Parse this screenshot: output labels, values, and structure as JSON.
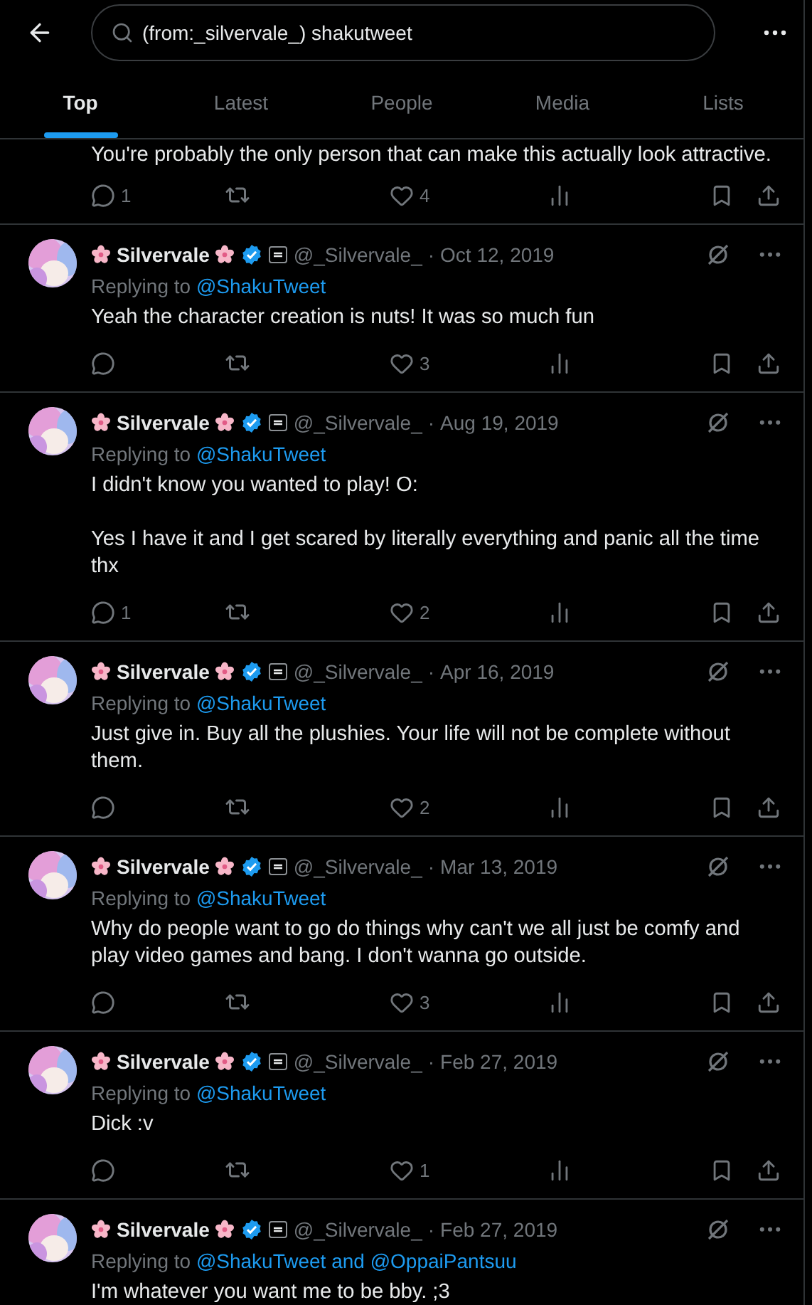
{
  "search": {
    "value": "(from:_silvervale_) shakutweet"
  },
  "tabs": [
    {
      "label": "Top",
      "selected": true
    },
    {
      "label": "Latest",
      "selected": false
    },
    {
      "label": "People",
      "selected": false
    },
    {
      "label": "Media",
      "selected": false
    },
    {
      "label": "Lists",
      "selected": false
    }
  ],
  "partial_tweet": {
    "text": [
      "You're probably the only person that can make this actually look attractive."
    ],
    "actions": {
      "replies": "1",
      "likes": "4"
    }
  },
  "tweets": [
    {
      "name": "Silvervale",
      "handle": "@_Silvervale_",
      "separator": "·",
      "date": "Oct 12, 2019",
      "replying_label": "Replying to",
      "replying_to": "@ShakuTweet",
      "text": [
        "Yeah the character creation is nuts! It was so much fun"
      ],
      "actions": {
        "likes": "3"
      }
    },
    {
      "name": "Silvervale",
      "handle": "@_Silvervale_",
      "separator": "·",
      "date": "Aug 19, 2019",
      "replying_label": "Replying to",
      "replying_to": "@ShakuTweet",
      "text": [
        "I didn't know you wanted to play! O:",
        "Yes I have it and I get scared by literally everything and panic all the time thx"
      ],
      "actions": {
        "replies": "1",
        "likes": "2"
      }
    },
    {
      "name": "Silvervale",
      "handle": "@_Silvervale_",
      "separator": "·",
      "date": "Apr 16, 2019",
      "replying_label": "Replying to",
      "replying_to": "@ShakuTweet",
      "text": [
        "Just give in. Buy all the plushies. Your life will not be complete without them."
      ],
      "actions": {
        "likes": "2"
      }
    },
    {
      "name": "Silvervale",
      "handle": "@_Silvervale_",
      "separator": "·",
      "date": "Mar 13, 2019",
      "replying_label": "Replying to",
      "replying_to": "@ShakuTweet",
      "text": [
        "Why do people want to go do things why can't we all just be comfy and play video games and bang. I don't wanna go outside."
      ],
      "actions": {
        "likes": "3"
      }
    },
    {
      "name": "Silvervale",
      "handle": "@_Silvervale_",
      "separator": "·",
      "date": "Feb 27, 2019",
      "replying_label": "Replying to",
      "replying_to": "@ShakuTweet",
      "text": [
        "Dick :v"
      ],
      "actions": {
        "likes": "1"
      }
    },
    {
      "name": "Silvervale",
      "handle": "@_Silvervale_",
      "separator": "·",
      "date": "Feb 27, 2019",
      "replying_label": "Replying to",
      "replying_to": "@ShakuTweet and @OppaiPantsuu",
      "text": [
        "I'm whatever you want me to be bby. ;3"
      ]
    }
  ]
}
